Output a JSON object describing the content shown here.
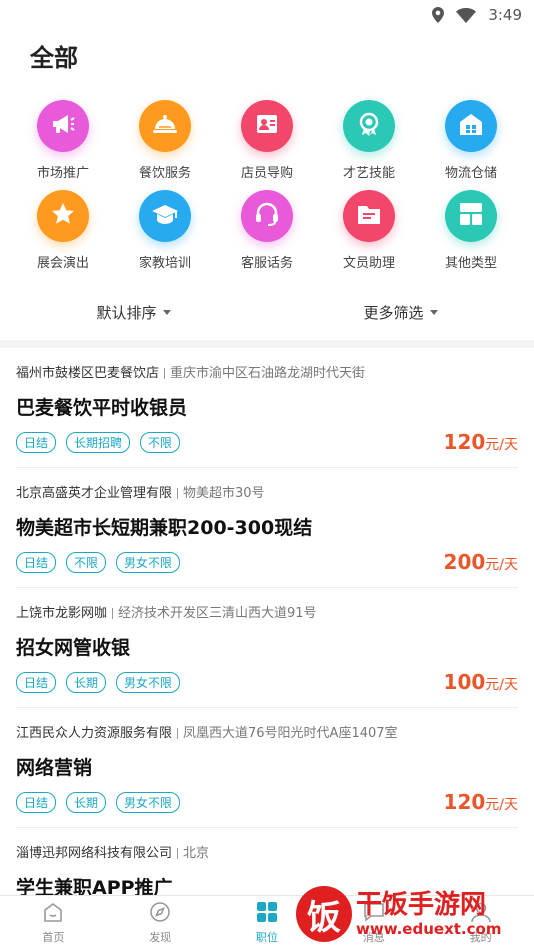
{
  "status_bar": {
    "time": "3:49"
  },
  "page": {
    "title": "全部"
  },
  "categories": [
    {
      "label": "市场推广",
      "icon": "megaphone-icon",
      "color": "#e85ad9"
    },
    {
      "label": "餐饮服务",
      "icon": "cloche-icon",
      "color": "#ff9a1f"
    },
    {
      "label": "店员导购",
      "icon": "clerk-card-icon",
      "color": "#f0476a"
    },
    {
      "label": "才艺技能",
      "icon": "medal-icon",
      "color": "#2bc8b6"
    },
    {
      "label": "物流仓储",
      "icon": "warehouse-icon",
      "color": "#27aaf0"
    },
    {
      "label": "展会演出",
      "icon": "star-icon",
      "color": "#ff9a1f"
    },
    {
      "label": "家教培训",
      "icon": "graduation-cap-icon",
      "color": "#27aaf0"
    },
    {
      "label": "客服话务",
      "icon": "headset-icon",
      "color": "#e85ad9"
    },
    {
      "label": "文员助理",
      "icon": "folder-icon",
      "color": "#f0476a"
    },
    {
      "label": "其他类型",
      "icon": "grid-icon",
      "color": "#2bc8b6"
    }
  ],
  "filters": {
    "sort": "默认排序",
    "more": "更多筛选"
  },
  "jobs": [
    {
      "company": "福州市鼓楼区巴麦餐饮店",
      "address": "重庆市渝中区石油路龙湖时代天街",
      "title": "巴麦餐饮平时收银员",
      "tags": [
        "日结",
        "长期招聘",
        "不限"
      ],
      "salary": "120",
      "unit": "元/天"
    },
    {
      "company": "北京高盛英才企业管理有限",
      "address": "物美超市30号",
      "title": "物美超市长短期兼职200-300现结",
      "tags": [
        "日结",
        "不限",
        "男女不限"
      ],
      "salary": "200",
      "unit": "元/天"
    },
    {
      "company": "上饶市龙影网咖",
      "address": "经济技术开发区三清山西大道91号",
      "title": "招女网管收银",
      "tags": [
        "日结",
        "长期",
        "男女不限"
      ],
      "salary": "100",
      "unit": "元/天"
    },
    {
      "company": "江西民众人力资源服务有限",
      "address": "凤凰西大道76号阳光时代A座1407室",
      "title": "网络营销",
      "tags": [
        "日结",
        "长期",
        "男女不限"
      ],
      "salary": "120",
      "unit": "元/天"
    },
    {
      "company": "淄博迅邦网络科技有限公司",
      "address": "北京",
      "title": "学生兼职APP推广",
      "tags": [],
      "salary": "",
      "unit": ""
    }
  ],
  "tab_bar": [
    {
      "label": "首页",
      "icon": "home-icon"
    },
    {
      "label": "发现",
      "icon": "compass-icon"
    },
    {
      "label": "职位",
      "icon": "grid-icon",
      "active": true
    },
    {
      "label": "消息",
      "icon": "message-icon"
    },
    {
      "label": "我的",
      "icon": "user-icon"
    }
  ],
  "watermark": {
    "logo": "饭",
    "name": "干饭手游网",
    "url": "www.eduext.com"
  },
  "colors": {
    "accent": "#1aa8c5",
    "salary": "#e8562a",
    "watermark": "#e02020"
  }
}
